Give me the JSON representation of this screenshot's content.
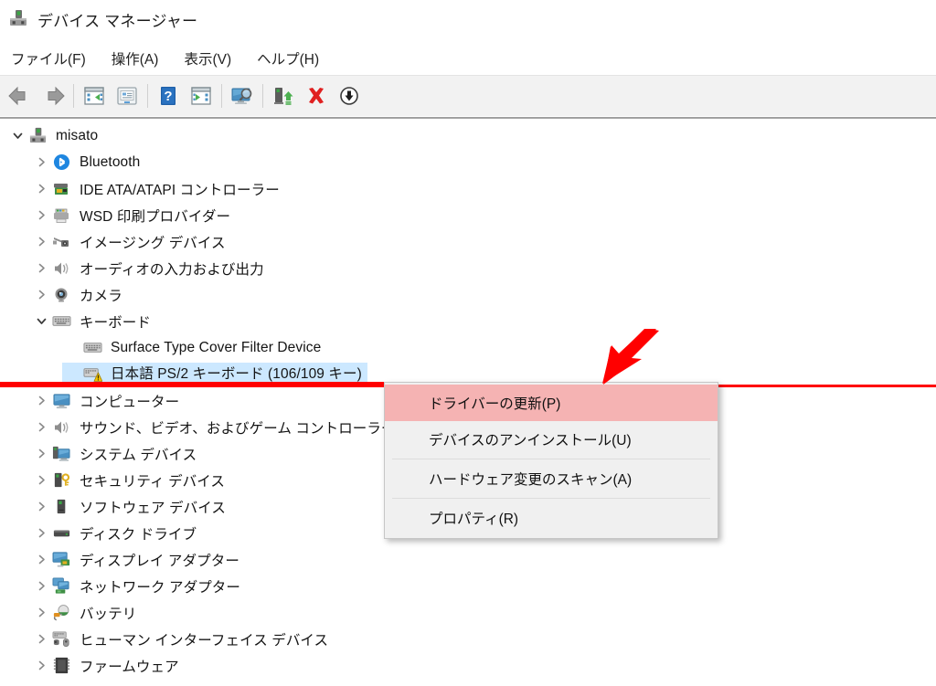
{
  "window": {
    "title": "デバイス マネージャー",
    "title_icon": "device-manager-icon"
  },
  "menubar": {
    "items": [
      {
        "label": "ファイル(F)",
        "name": "menu-file"
      },
      {
        "label": "操作(A)",
        "name": "menu-action"
      },
      {
        "label": "表示(V)",
        "name": "menu-view"
      },
      {
        "label": "ヘルプ(H)",
        "name": "menu-help"
      }
    ]
  },
  "toolbar": {
    "buttons": [
      {
        "name": "back-arrow-icon",
        "tip": "戻る"
      },
      {
        "name": "forward-arrow-icon",
        "tip": "進む"
      },
      {
        "name": "properties-panel-icon",
        "tip": "プロパティ"
      },
      {
        "name": "show-details-icon",
        "tip": "詳細"
      },
      {
        "name": "help-icon",
        "tip": "ヘルプ"
      },
      {
        "name": "hide-console-tree-icon",
        "tip": "コンソール ツリー"
      },
      {
        "name": "scan-hardware-icon",
        "tip": "ハードウェア変更のスキャン"
      },
      {
        "name": "update-driver-icon",
        "tip": "ドライバーの更新"
      },
      {
        "name": "uninstall-device-icon",
        "tip": "デバイスのアンインストール"
      },
      {
        "name": "disable-device-icon",
        "tip": "デバイスを無効にする"
      }
    ]
  },
  "tree": {
    "root": {
      "label": "misato",
      "icon": "computer-root-icon",
      "expanded": true
    },
    "nodes": [
      {
        "label": "Bluetooth",
        "icon": "bluetooth-icon",
        "level": 1,
        "expanded": false
      },
      {
        "label": "IDE ATA/ATAPI コントローラー",
        "icon": "ide-controller-icon",
        "level": 1,
        "expanded": false
      },
      {
        "label": "WSD 印刷プロバイダー",
        "icon": "printer-icon",
        "level": 1,
        "expanded": false
      },
      {
        "label": "イメージング デバイス",
        "icon": "imaging-device-icon",
        "level": 1,
        "expanded": false
      },
      {
        "label": "オーディオの入力および出力",
        "icon": "speaker-icon",
        "level": 1,
        "expanded": false
      },
      {
        "label": "カメラ",
        "icon": "camera-icon",
        "level": 1,
        "expanded": false
      },
      {
        "label": "キーボード",
        "icon": "keyboard-icon",
        "level": 1,
        "expanded": true
      },
      {
        "label": "Surface Type Cover Filter Device",
        "icon": "keyboard-icon",
        "level": 2,
        "leaf": true
      },
      {
        "label": "日本語 PS/2 キーボード (106/109 キー)",
        "icon": "keyboard-warning-icon",
        "level": 2,
        "leaf": true,
        "selected": true,
        "warning": true
      },
      {
        "label": "コンピューター",
        "icon": "monitor-icon",
        "level": 1,
        "expanded": false
      },
      {
        "label": "サウンド、ビデオ、およびゲーム コントローラー",
        "icon": "speaker-icon",
        "level": 1,
        "expanded": false
      },
      {
        "label": "システム デバイス",
        "icon": "system-device-icon",
        "level": 1,
        "expanded": false
      },
      {
        "label": "セキュリティ デバイス",
        "icon": "security-device-icon",
        "level": 1,
        "expanded": false
      },
      {
        "label": "ソフトウェア デバイス",
        "icon": "software-device-icon",
        "level": 1,
        "expanded": false
      },
      {
        "label": "ディスク ドライブ",
        "icon": "disk-drive-icon",
        "level": 1,
        "expanded": false
      },
      {
        "label": "ディスプレイ アダプター",
        "icon": "display-adapter-icon",
        "level": 1,
        "expanded": false
      },
      {
        "label": "ネットワーク アダプター",
        "icon": "network-adapter-icon",
        "level": 1,
        "expanded": false
      },
      {
        "label": "バッテリ",
        "icon": "battery-icon",
        "level": 1,
        "expanded": false
      },
      {
        "label": "ヒューマン インターフェイス デバイス",
        "icon": "hid-icon",
        "level": 1,
        "expanded": false
      },
      {
        "label": "ファームウェア",
        "icon": "firmware-icon",
        "level": 1,
        "expanded": false
      }
    ]
  },
  "context_menu": {
    "items": [
      {
        "label": "ドライバーの更新(P)",
        "name": "ctx-update-driver",
        "highlighted": true,
        "separator_after": false
      },
      {
        "label": "デバイスのアンインストール(U)",
        "name": "ctx-uninstall-device",
        "highlighted": false,
        "separator_after": true
      },
      {
        "label": "ハードウェア変更のスキャン(A)",
        "name": "ctx-scan-hardware",
        "highlighted": false,
        "separator_after": true
      },
      {
        "label": "プロパティ(R)",
        "name": "ctx-properties",
        "highlighted": false,
        "separator_after": false
      }
    ]
  },
  "annotation": {
    "arrow": "red-pointer-arrow",
    "arrow_color": "#ff0000"
  },
  "colors": {
    "selection_blue": "#cce8ff",
    "menu_highlight": "#f5b3b3",
    "annotation_red": "#ff0000",
    "toolbar_bg": "#f2f2f2",
    "menu_bg": "#f0f0f0"
  }
}
